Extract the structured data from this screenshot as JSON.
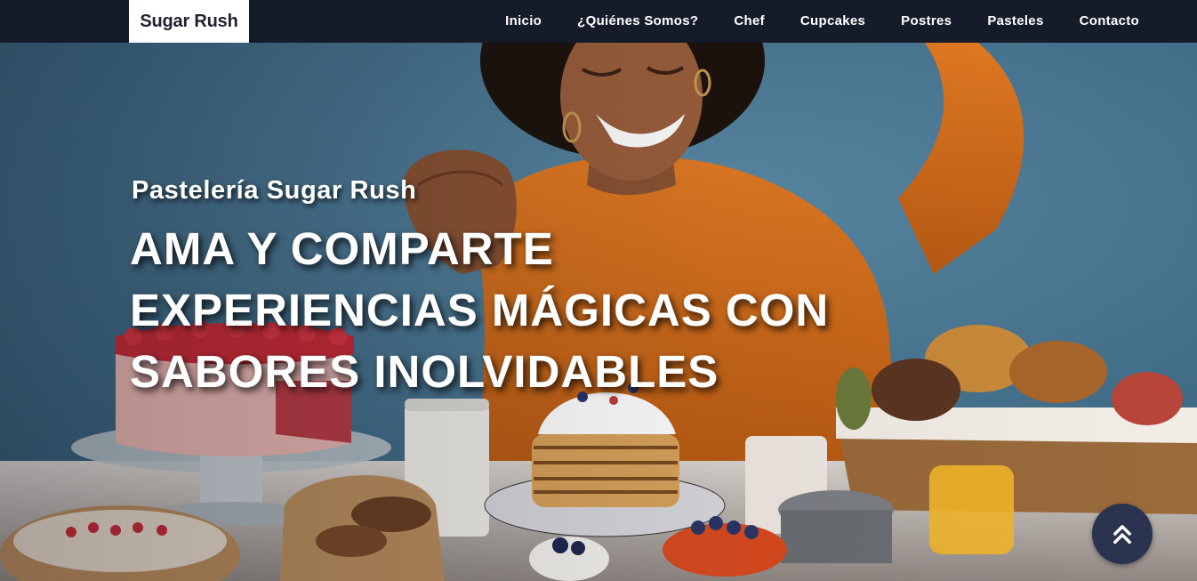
{
  "navbar": {
    "brand": "Sugar Rush",
    "links": [
      {
        "label": "Inicio"
      },
      {
        "label": "¿Quiénes Somos?"
      },
      {
        "label": "Chef"
      },
      {
        "label": "Cupcakes"
      },
      {
        "label": "Postres"
      },
      {
        "label": "Pasteles"
      },
      {
        "label": "Contacto"
      }
    ]
  },
  "hero": {
    "subtitle": "Pastelería Sugar Rush",
    "headline": "AMA Y COMPARTE EXPERIENCIAS MÁGICAS CON SABORES INOLVIDABLES",
    "background_image": "woman-in-orange-sweater-with-desserts-photo"
  },
  "scroll_top": {
    "icon": "double-chevron-up-icon"
  },
  "colors": {
    "navbar_bg": "#161b29",
    "brand_bg": "#ffffff",
    "brand_text": "#1e2230",
    "hero_bg": "#3f6f88",
    "sweater": "#d9701e",
    "scroll_button": "#2a3350"
  }
}
